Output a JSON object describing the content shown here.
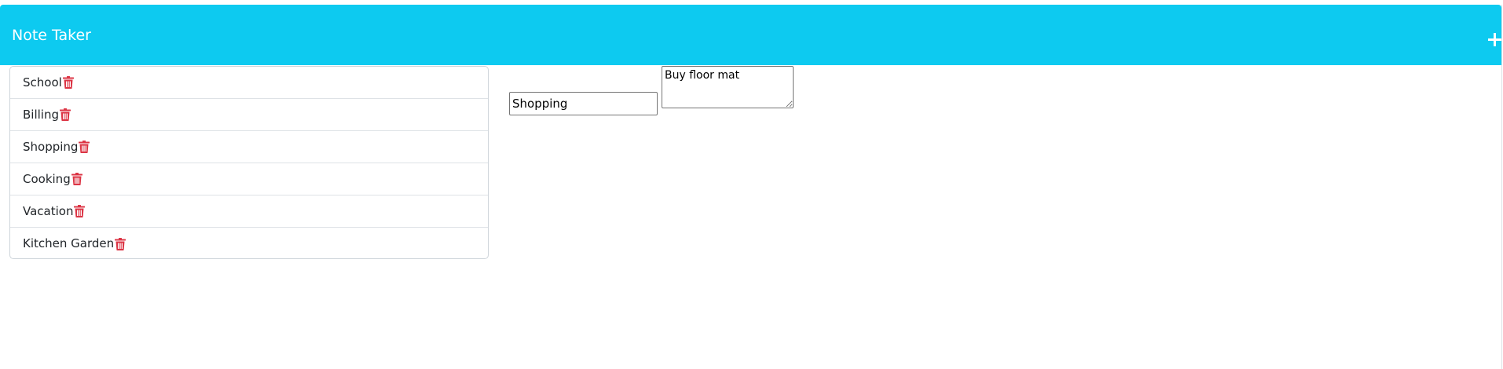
{
  "app": {
    "title": "Note Taker"
  },
  "navbar": {
    "add_icon": "plus-icon"
  },
  "notes": [
    {
      "label": "School",
      "delete_icon": "trash-icon"
    },
    {
      "label": "Billing",
      "delete_icon": "trash-icon"
    },
    {
      "label": "Shopping",
      "delete_icon": "trash-icon"
    },
    {
      "label": "Cooking",
      "delete_icon": "trash-icon"
    },
    {
      "label": "Vacation",
      "delete_icon": "trash-icon"
    },
    {
      "label": "Kitchen Garden",
      "delete_icon": "trash-icon"
    }
  ],
  "editor": {
    "title_value": "Shopping",
    "body_value": "Buy floor mat"
  },
  "colors": {
    "navbar": "#0dcaf0",
    "delete_icon": "#dc3545"
  }
}
